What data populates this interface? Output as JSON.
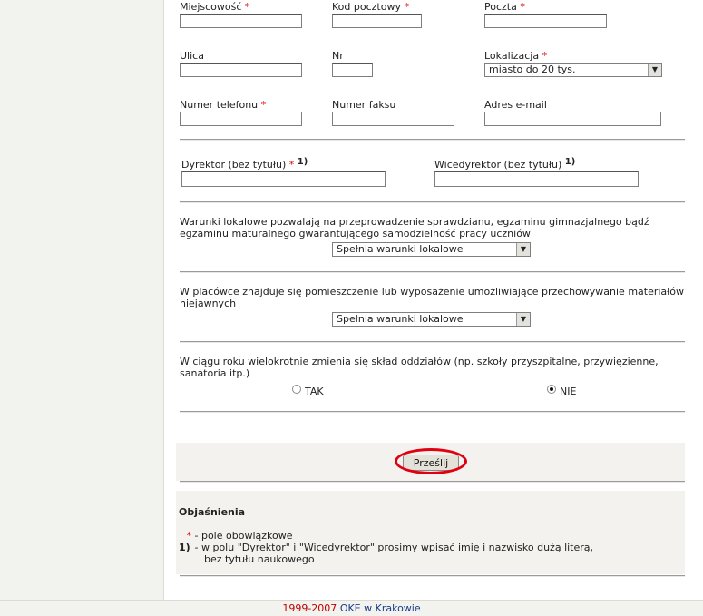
{
  "form": {
    "row1": {
      "city_label": "Miejscowość",
      "postal_label": "Kod pocztowy",
      "post_label": "Poczta",
      "required_mark": "*"
    },
    "row2": {
      "street_label": "Ulica",
      "nr_label": "Nr",
      "location_label": "Lokalizacja",
      "location_value": "miasto do 20 tys."
    },
    "row3": {
      "phone_label": "Numer telefonu",
      "fax_label": "Numer faksu",
      "email_label": "Adres e-mail"
    },
    "row4": {
      "director_label": "Dyrektor (bez tytułu)",
      "vice_label": "Wicedyrektor (bez tytułu)",
      "footnote_mark": "1)"
    },
    "q1": {
      "text": "Warunki lokalowe pozwalają na przeprowadzenie sprawdzianu, egzaminu gimnazjalnego bądź egzaminu maturalnego gwarantującego samodzielność pracy uczniów",
      "value": "Spełnia warunki lokalowe"
    },
    "q2": {
      "text": "W placówce znajduje się pomieszczenie lub wyposażenie umożliwiające przechowywanie materiałów niejawnych",
      "value": "Spełnia warunki lokalowe"
    },
    "q3": {
      "text": "W ciągu roku wielokrotnie zmienia się skład oddziałów (np. szkoły przyszpitalne, przywięzienne, sanatoria itp.)",
      "yes_label": "TAK",
      "no_label": "NIE",
      "selected": "NIE"
    },
    "submit_label": "Prześlij"
  },
  "notes": {
    "title": "Objaśnienia",
    "star_mark": "*",
    "star_text": "- pole obowiązkowe",
    "one_mark": "1)",
    "one_text_1": "- w polu \"Dyrektor\" i \"Wicedyrektor\" prosimy wpisać imię i nazwisko dużą literą,",
    "one_text_2": "bez tytułu naukowego"
  },
  "footer": {
    "years": "1999-2007",
    "org": "OKE w Krakowie"
  },
  "colors": {
    "required": "#e00000",
    "highlight_ring": "#e00010",
    "footer_years": "#c00000",
    "footer_org": "#1a3a8a"
  }
}
